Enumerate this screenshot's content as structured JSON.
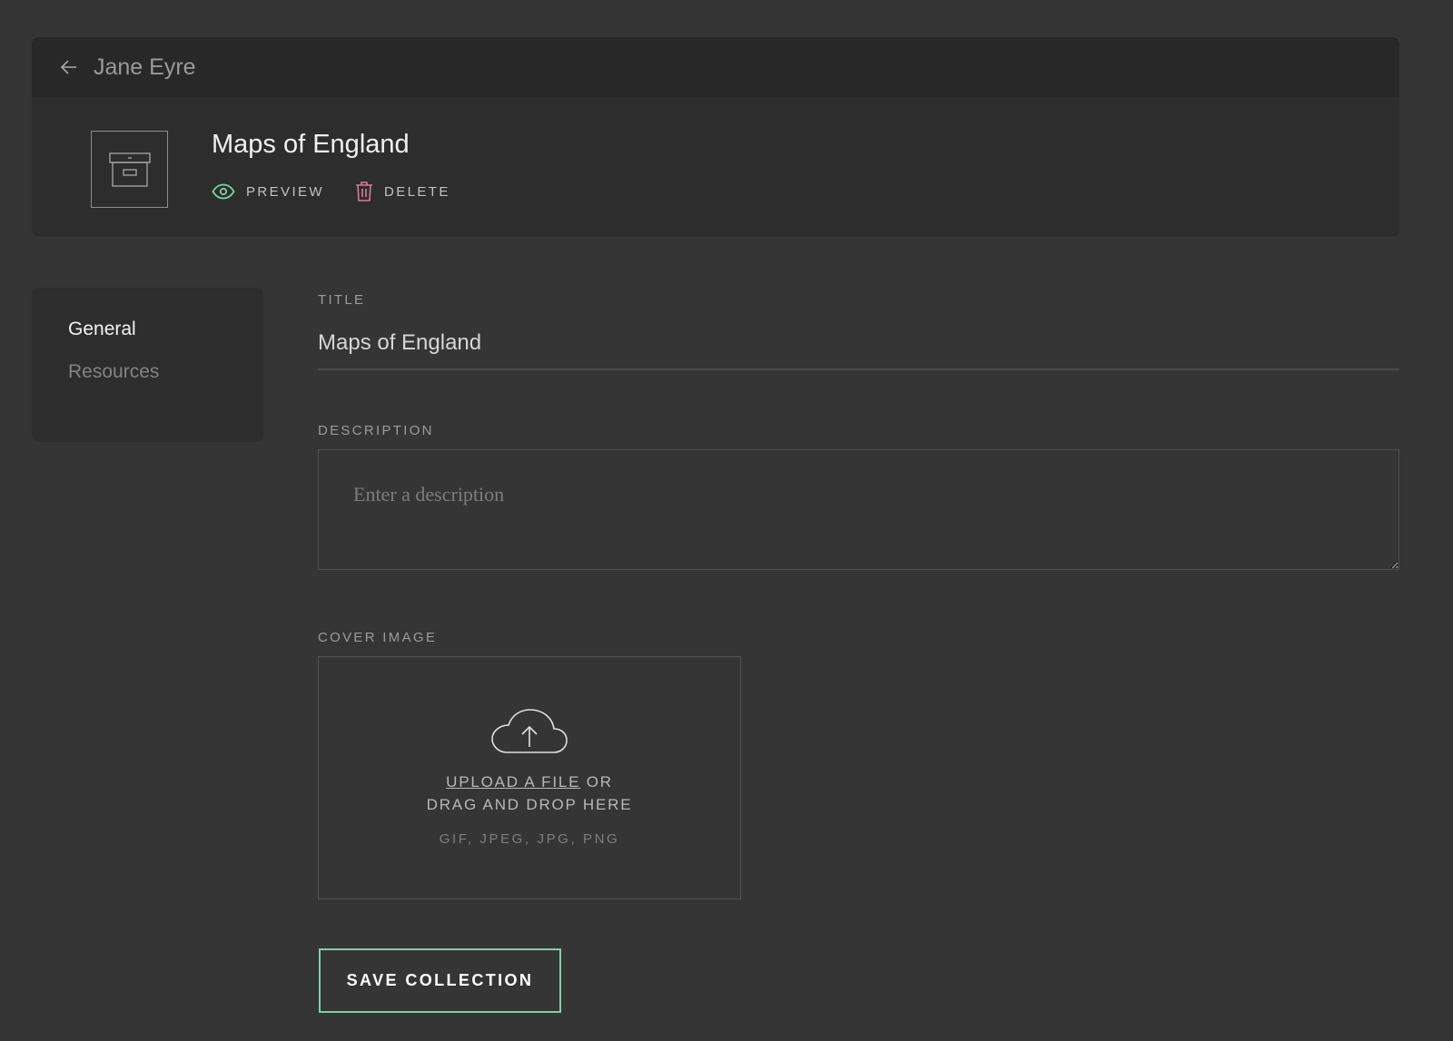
{
  "header": {
    "back_icon": "arrow-left-icon",
    "parent_title": "Jane Eyre",
    "collection_icon": "archive-box-icon",
    "collection_title": "Maps of England",
    "preview_label": "PREVIEW",
    "delete_label": "DELETE"
  },
  "sidebar": {
    "items": [
      {
        "label": "General",
        "active": true
      },
      {
        "label": "Resources",
        "active": false
      }
    ]
  },
  "form": {
    "title_label": "TITLE",
    "title_value": "Maps of England",
    "description_label": "DESCRIPTION",
    "description_placeholder": "Enter a description",
    "description_value": "",
    "cover_label": "COVER IMAGE",
    "upload_link": "UPLOAD A FILE",
    "upload_or": " OR",
    "upload_drag": "DRAG AND DROP HERE",
    "formats": "GIF, JPEG, JPG, PNG",
    "save_button": "SAVE COLLECTION"
  },
  "colors": {
    "preview_icon": "#7dcfa9",
    "delete_icon": "#d9799c",
    "save_border": "#7dcfa9",
    "background": "#353535"
  }
}
